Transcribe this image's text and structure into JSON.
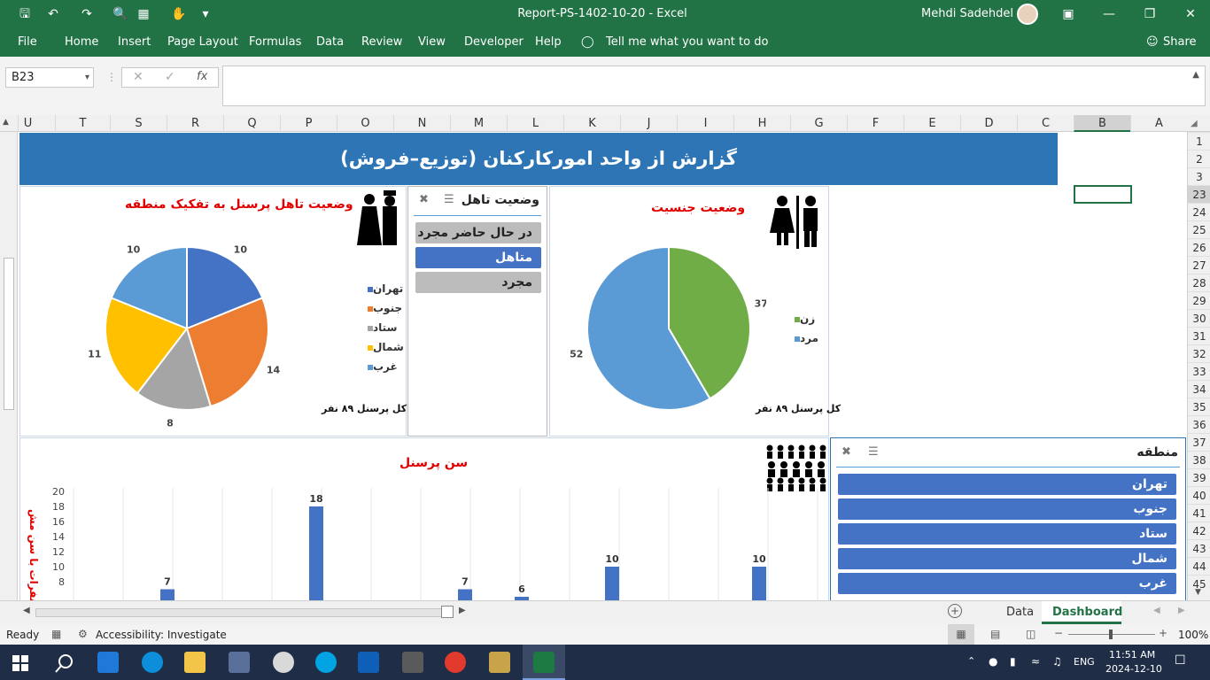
{
  "window": {
    "title": "Report-PS-1402-10-20  -  Excel",
    "user": "Mehdi Sadehdel"
  },
  "ribbon": {
    "tabs": [
      "File",
      "Home",
      "Insert",
      "Page Layout",
      "Formulas",
      "Data",
      "Review",
      "View",
      "Developer",
      "Help"
    ],
    "tell_me": "Tell me what you want to do",
    "share": "Share"
  },
  "formula_bar": {
    "name_box": "B23",
    "fx": "fx",
    "value": ""
  },
  "columns": [
    "U",
    "T",
    "S",
    "R",
    "Q",
    "P",
    "O",
    "N",
    "M",
    "L",
    "K",
    "J",
    "I",
    "H",
    "G",
    "F",
    "E",
    "D",
    "C",
    "B",
    "A"
  ],
  "rows": [
    "1",
    "2",
    "3",
    "23",
    "24",
    "25",
    "26",
    "27",
    "28",
    "29",
    "30",
    "31",
    "32",
    "33",
    "34",
    "35",
    "36",
    "37",
    "38",
    "39",
    "40",
    "41",
    "42",
    "43",
    "44",
    "45"
  ],
  "dashboard": {
    "banner_title": "گزارش از واحد امورکارکنان (توزیع–فروش)",
    "marital_chart": {
      "title": "وضعیت تاهل پرسنل به تفکیک منطقه",
      "total": "کل پرسنل ۸۹ نفر",
      "legend": [
        "تهران",
        "جنوب",
        "ستاد",
        "شمال",
        "غرب"
      ],
      "colors": [
        "#4472c4",
        "#ed7d31",
        "#a5a5a5",
        "#ffc000",
        "#5b9bd5"
      ]
    },
    "marital_slicer": {
      "title": "وضعیت تاهل",
      "items": [
        "در حال حاضر مجرد",
        "متاهل",
        "مجرد"
      ],
      "selected": 1
    },
    "gender_chart": {
      "title": "وضعیت  جنسیت",
      "total": "کل پرسنل ۸۹ نفر",
      "legend": [
        "زن",
        "مرد"
      ],
      "colors": [
        "#70ad47",
        "#5b9bd5"
      ]
    },
    "age_chart": {
      "title": "سن پرسنل",
      "ylabel": "تعداد نفرات با سن مش",
      "bar_color": "#4472c4"
    },
    "region_slicer": {
      "title": "منطقه",
      "items": [
        "تهران",
        "جنوب",
        "ستاد",
        "شمال",
        "غرب"
      ]
    }
  },
  "chart_data": [
    {
      "type": "pie",
      "title": "وضعیت تاهل پرسنل به تفکیک منطقه",
      "categories": [
        "تهران",
        "جنوب",
        "ستاد",
        "شمال",
        "غرب"
      ],
      "values": [
        10,
        14,
        8,
        11,
        10
      ]
    },
    {
      "type": "pie",
      "title": "وضعیت  جنسیت",
      "categories": [
        "زن",
        "مرد"
      ],
      "values": [
        37,
        52
      ]
    },
    {
      "type": "bar",
      "title": "سن پرسنل",
      "ylabel": "تعداد نفرات با سن مش",
      "ylim": [
        0,
        20
      ],
      "yticks": [
        8,
        10,
        12,
        14,
        16,
        18,
        20
      ],
      "values": [
        7,
        18,
        7,
        6,
        10,
        10
      ]
    }
  ],
  "sheet_tabs": [
    "Data",
    "Dashboard"
  ],
  "active_tab": "Dashboard",
  "status": {
    "ready": "Ready",
    "accessibility": "Accessibility: Investigate",
    "zoom": "100%"
  },
  "taskbar": {
    "lang": "ENG",
    "time": "11:51 AM",
    "date": "2024-12-10"
  }
}
